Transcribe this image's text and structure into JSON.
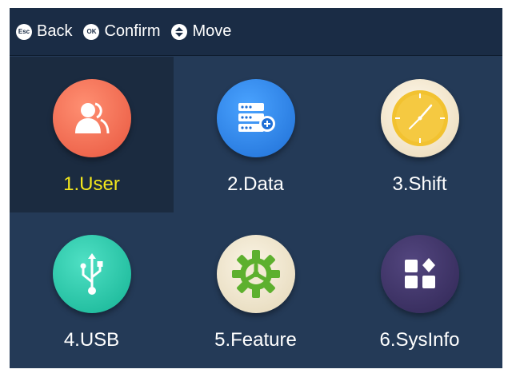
{
  "topbar": {
    "hints": [
      {
        "key": "Esc",
        "label": "Back",
        "icon": "esc-key-icon"
      },
      {
        "key": "OK",
        "label": "Confirm",
        "icon": "ok-key-icon"
      },
      {
        "key": "up-down",
        "label": "Move",
        "icon": "up-down-arrows-icon"
      }
    ]
  },
  "menu": {
    "selected_index": 0,
    "highlight_color": "#f3e71c",
    "items": [
      {
        "label": "1.User",
        "icon": "user-icon",
        "color": "#ee6a50"
      },
      {
        "label": "2.Data",
        "icon": "data-server-icon",
        "color": "#2f86e6"
      },
      {
        "label": "3.Shift",
        "icon": "clock-icon",
        "color": "#f2c230"
      },
      {
        "label": "4.USB",
        "icon": "usb-icon",
        "color": "#21c6a8"
      },
      {
        "label": "5.Feature",
        "icon": "gear-icon",
        "color": "#5db02e"
      },
      {
        "label": "6.SysInfo",
        "icon": "system-info-icon",
        "color": "#3f3466"
      }
    ]
  }
}
